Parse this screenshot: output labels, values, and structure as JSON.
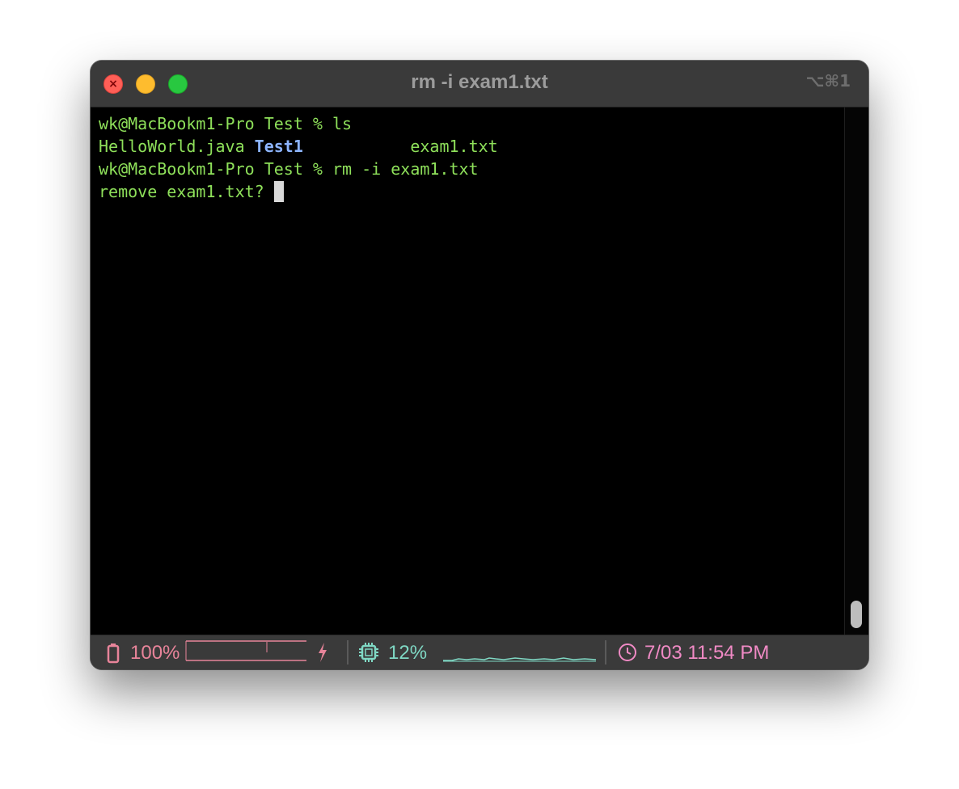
{
  "window": {
    "title": "rm -i exam1.txt",
    "shortcut": "⌥⌘1"
  },
  "terminal": {
    "lines": [
      {
        "prompt": "wk@MacBookm1-Pro Test % ",
        "command": "ls"
      },
      {
        "file1": "HelloWorld.java ",
        "dir": "Test1",
        "gap": "           ",
        "file2": "exam1.txt"
      },
      {
        "prompt": "wk@MacBookm1-Pro Test % ",
        "command": "rm -i exam1.txt"
      },
      {
        "text": "remove exam1.txt? "
      }
    ],
    "colors": {
      "text": "#8ee05a",
      "directory": "#8cb4ff",
      "cursor": "#d9d9d9"
    }
  },
  "status": {
    "battery_icon": "battery-icon",
    "battery_value": "100%",
    "charging_icon": "bolt-icon",
    "cpu_icon": "cpu-chip-icon",
    "cpu_value": "12%",
    "clock_icon": "clock-icon",
    "datetime": "7/03 11:54 PM",
    "colors": {
      "battery": "#e8849a",
      "cpu": "#7fd8c4",
      "clock": "#f08ac5"
    }
  }
}
